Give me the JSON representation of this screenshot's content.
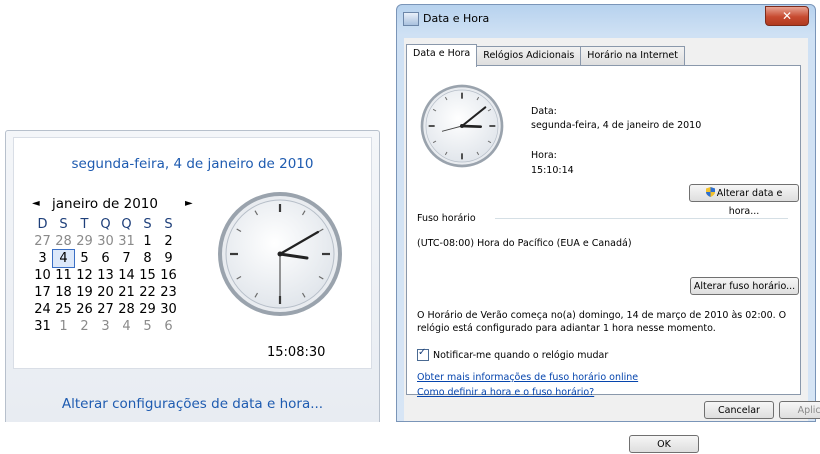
{
  "flyout": {
    "full_date": "segunda-feira, 4 de janeiro de 2010",
    "prev_arrow": "◄",
    "next_arrow": "►",
    "month_year": "janeiro de 2010",
    "weekday_headers": [
      "D",
      "S",
      "T",
      "Q",
      "Q",
      "S",
      "S"
    ],
    "weeks": [
      [
        "27",
        "28",
        "29",
        "30",
        "31",
        "1",
        "2"
      ],
      [
        "3",
        "4",
        "5",
        "6",
        "7",
        "8",
        "9"
      ],
      [
        "10",
        "11",
        "12",
        "13",
        "14",
        "15",
        "16"
      ],
      [
        "17",
        "18",
        "19",
        "20",
        "21",
        "22",
        "23"
      ],
      [
        "24",
        "25",
        "26",
        "27",
        "28",
        "29",
        "30"
      ],
      [
        "31",
        "1",
        "2",
        "3",
        "4",
        "5",
        "6"
      ]
    ],
    "today": "4",
    "time": "15:08:30",
    "change_settings_link": "Alterar configurações de data e hora..."
  },
  "dialog": {
    "title": "Data e Hora",
    "close_glyph": "✕",
    "tabs": [
      {
        "label": "Data e Hora",
        "active": true
      },
      {
        "label": "Relógios Adicionais",
        "active": false
      },
      {
        "label": "Horário na Internet",
        "active": false
      }
    ],
    "date_label": "Data:",
    "date_value": "segunda-feira, 4 de janeiro de 2010",
    "time_label": "Hora:",
    "time_value": "15:10:14",
    "change_date_time_button": "Alterar data e hora...",
    "timezone_section": "Fuso horário",
    "timezone_value": "(UTC-08:00) Hora do Pacífico (EUA e Canadá)",
    "change_timezone_button": "Alterar fuso horário...",
    "dst_text": "O Horário de Verão começa no(a) domingo, 14 de março de 2010 às 02:00. O relógio está configurado para adiantar 1 hora nesse momento.",
    "notify_label": "Notificar-me quando o relógio mudar",
    "notify_checked": true,
    "link_timezone_info": "Obter mais informações de fuso horário online",
    "link_set_time": "Como definir a hora e o fuso horário?",
    "ok_button": "OK",
    "cancel_button": "Cancelar",
    "apply_button": "Aplicar"
  },
  "colors": {
    "link_blue": "#1e5bb0",
    "close_red": "#c74a30"
  }
}
